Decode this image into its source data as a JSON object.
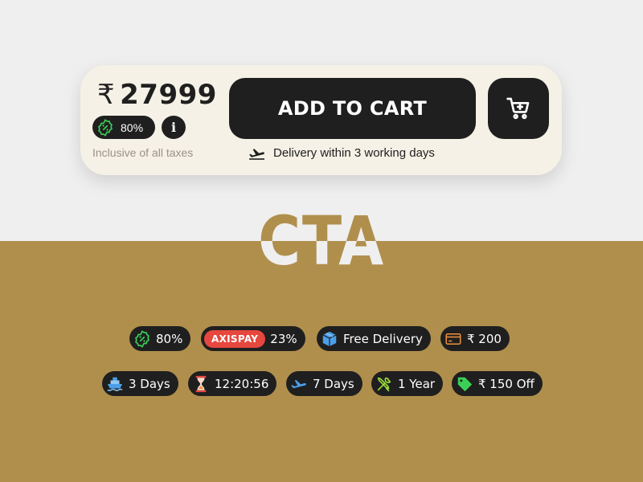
{
  "card": {
    "currency_symbol": "₹",
    "price": "27999",
    "discount": "80%",
    "info_label": "i",
    "tax_note": "Inclusive of all taxes",
    "add_to_cart_label": "ADD TO CART",
    "delivery_text": "Delivery within 3 working days"
  },
  "title": "CTA",
  "chips": {
    "discount": "80%",
    "bank_offer_tag": "AXISPAY",
    "bank_offer_value": "23%",
    "free_delivery": "Free Delivery",
    "card_offer": "₹ 200",
    "shipping_days": "3 Days",
    "timer": "12:20:56",
    "express_days": "7 Days",
    "warranty": "1 Year",
    "coupon": "₹ 150 Off"
  },
  "icons": {
    "discount": "discount-badge-icon",
    "info": "info-icon",
    "cart": "shopping-cart-icon",
    "delivery": "airplane-takeoff-icon",
    "free_delivery": "package-icon",
    "card_offer": "credit-card-icon",
    "shipping": "ship-icon",
    "timer": "hourglass-icon",
    "express": "airplane-icon",
    "warranty": "tools-icon",
    "coupon": "price-tag-icon"
  },
  "colors": {
    "dark": "#1f1f1f",
    "card_bg": "#f6f1e6",
    "gold": "#b08f4d",
    "light_bg": "#efefef",
    "discount_green": "#3ccf57",
    "axis_red": "#e6473e",
    "muted_text": "#999189"
  }
}
